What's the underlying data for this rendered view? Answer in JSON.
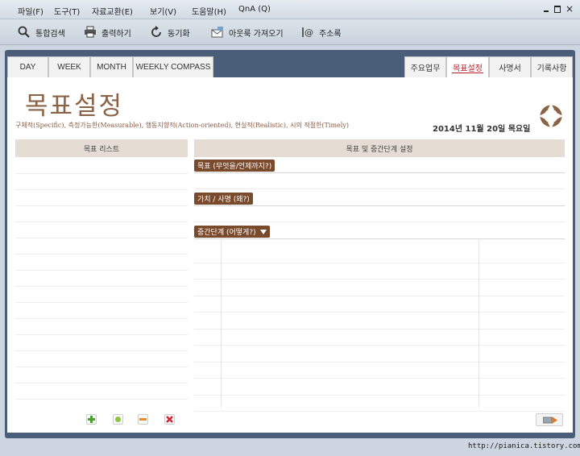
{
  "menu": [
    "파일(F)",
    "도구(T)",
    "자료교환(E)",
    "보기(V)",
    "도움말(H)",
    "QnA (Q)"
  ],
  "window_controls": {
    "close": "×"
  },
  "toolbar": {
    "search": "통합검색",
    "print": "출력하기",
    "sync": "동기화",
    "import": "아웃룩 가져오기",
    "addressbook": "주소록"
  },
  "tabs_left": [
    "DAY",
    "WEEK",
    "MONTH",
    "WEEKLY COMPASS"
  ],
  "tabs_right": [
    "주요업무",
    "목표설정",
    "사명서",
    "기록사항"
  ],
  "active_tab": "목표설정",
  "page": {
    "title": "목표설정",
    "subtitle": "구체적(Specific), 측정가능한(Measurable), 행동지향적(Action-oriented), 현실적(Realistic), 시의 적절한(Timely)",
    "date": "2014년  11월  20일  목요일"
  },
  "left_panel": {
    "header": "목표 리스트"
  },
  "right_panel": {
    "header": "목표 및 중간단계 설정",
    "goal_label": "목표 (무엇을/언제까지?)",
    "value_label": "가치 / 사명 (왜?)",
    "steps_label": "중간단계 (어떻게?)"
  },
  "footer": {
    "url": "http://pianica.tistory.com"
  },
  "colors": {
    "accent": "#b8202a",
    "brown": "#7a4a2c",
    "frame": "#4a5d79"
  }
}
